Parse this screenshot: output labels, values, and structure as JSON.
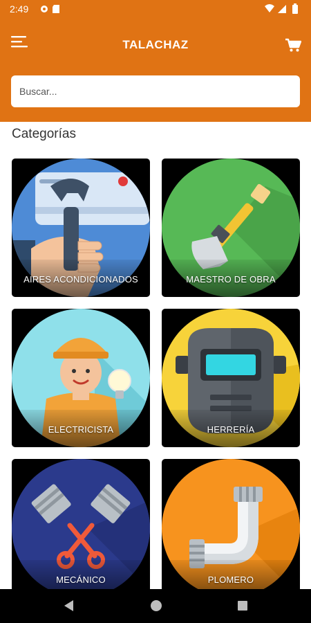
{
  "status_bar": {
    "time": "2:49"
  },
  "app_bar": {
    "title": "TALACHAZ"
  },
  "search": {
    "placeholder": "Buscar..."
  },
  "section_title": "Categorías",
  "categories": [
    {
      "label": "AIRES ACONDICIONADOS",
      "icon": "air-conditioner-wrench-icon"
    },
    {
      "label": "MAESTRO DE OBRA",
      "icon": "shovel-icon"
    },
    {
      "label": "ELECTRICISTA",
      "icon": "electrician-icon"
    },
    {
      "label": "HERRERÍA",
      "icon": "welding-mask-icon"
    },
    {
      "label": "MECÁNICO",
      "icon": "pistons-icon"
    },
    {
      "label": "PLOMERO",
      "icon": "pipe-icon"
    }
  ],
  "colors": {
    "primary": "#E07314",
    "text": "#333333"
  }
}
